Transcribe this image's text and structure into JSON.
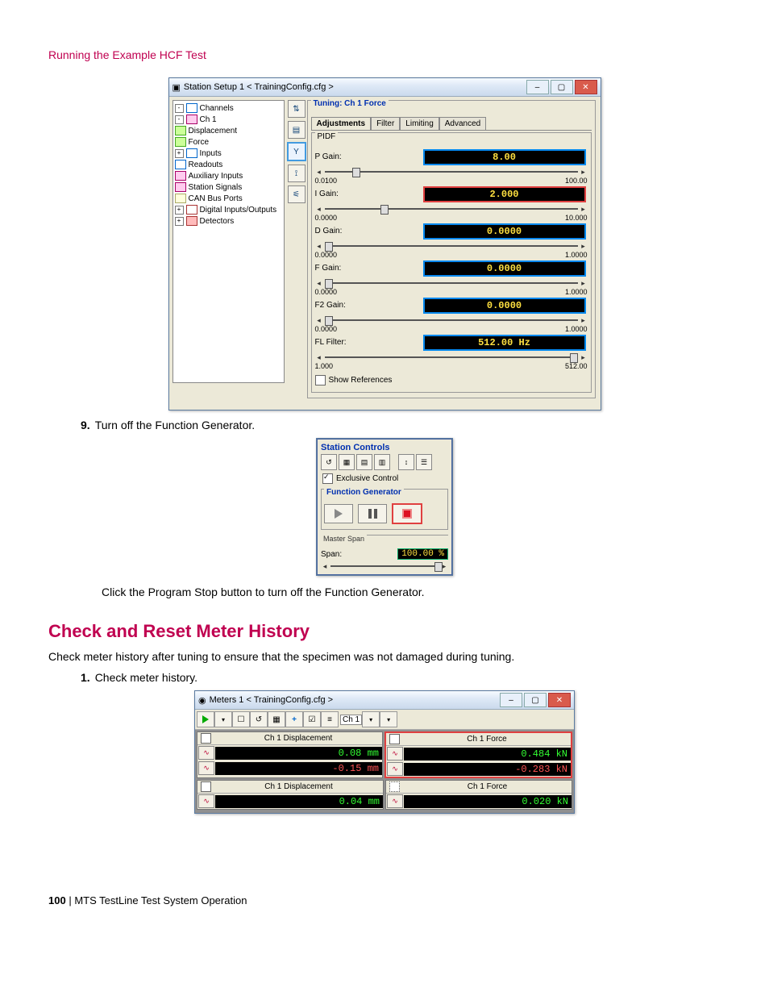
{
  "running_head": "Running the Example HCF Test",
  "station_setup": {
    "title": "Station Setup 1 < TrainingConfig.cfg >",
    "tree": {
      "root": "Channels",
      "ch1": "Ch 1",
      "displacement": "Displacement",
      "force": "Force",
      "inputs": "Inputs",
      "readouts": "Readouts",
      "aux_inputs": "Auxiliary Inputs",
      "station_signals": "Station Signals",
      "can_bus": "CAN Bus Ports",
      "dio": "Digital Inputs/Outputs",
      "detectors": "Detectors"
    },
    "tuning_title": "Tuning:  Ch 1 Force",
    "tabs": {
      "adjustments": "Adjustments",
      "filter": "Filter",
      "limiting": "Limiting",
      "advanced": "Advanced"
    },
    "pidf_label": "PIDF",
    "gains": {
      "p": {
        "label": "P Gain:",
        "value": "8.00",
        "min": "0.0100",
        "max": "100.00"
      },
      "i": {
        "label": "I Gain:",
        "value": "2.000",
        "min": "0.0000",
        "max": "10.000"
      },
      "d": {
        "label": "D Gain:",
        "value": "0.0000",
        "min": "0.0000",
        "max": "1.0000"
      },
      "f": {
        "label": "F Gain:",
        "value": "0.0000",
        "min": "0.0000",
        "max": "1.0000"
      },
      "f2": {
        "label": "F2 Gain:",
        "value": "0.0000",
        "min": "0.0000",
        "max": "1.0000"
      },
      "fl": {
        "label": "FL Filter:",
        "value": "512.00 Hz",
        "min": "1.000",
        "max": "512.00"
      }
    },
    "show_refs": "Show References"
  },
  "step9": {
    "num": "9.",
    "text": "Turn off the Function Generator."
  },
  "station_controls": {
    "title": "Station Controls",
    "exclusive": "Exclusive Control",
    "fg_title": "Function Generator",
    "master_span": "Master Span",
    "span_label": "Span:",
    "span_value": "100.00 %"
  },
  "click_stop": "Click the Program Stop button to turn off the Function Generator.",
  "section_h2": "Check and Reset Meter History",
  "intro": "Check meter history after tuning to ensure that the specimen was not damaged during tuning.",
  "step1": {
    "num": "1.",
    "text": "Check meter history."
  },
  "meters": {
    "title": "Meters 1 < TrainingConfig.cfg >",
    "sel": "Ch 1",
    "rows": [
      {
        "left_hdr": "Ch 1 Displacement",
        "right_hdr": "Ch 1 Force",
        "left_v1": "0.08 mm",
        "left_v2": "-0.15 mm",
        "right_v1": "0.484 kN",
        "right_v2": "-0.283 kN"
      },
      {
        "left_hdr": "Ch 1 Displacement",
        "right_hdr": "Ch 1 Force",
        "left_v1": "0.04 mm",
        "right_v1": "0.020 kN"
      }
    ]
  },
  "footer": {
    "page": "100",
    "sep": " | ",
    "doc": "MTS TestLine Test System Operation"
  }
}
